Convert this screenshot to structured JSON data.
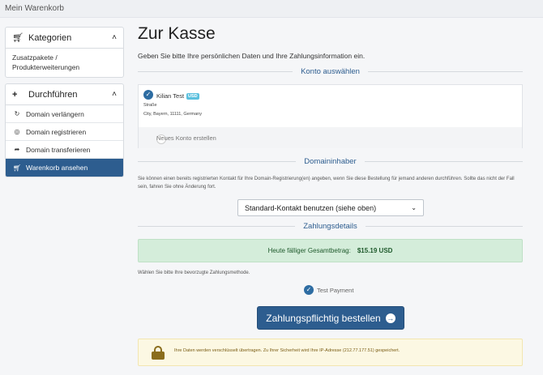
{
  "topbar": {
    "breadcrumb": "Mein Warenkorb"
  },
  "sidebar": {
    "categories": {
      "title": "Kategorien",
      "body": "Zusatzpakete / Produkterweiterungen"
    },
    "actions": {
      "title": "Durchführen",
      "items": [
        {
          "label": "Domain verlängern",
          "icon": "refresh-icon"
        },
        {
          "label": "Domain registrieren",
          "icon": "globe-icon"
        },
        {
          "label": "Domain transferieren",
          "icon": "share-icon"
        },
        {
          "label": "Warenkorb ansehen",
          "icon": "cart-icon",
          "active": true
        }
      ]
    }
  },
  "main": {
    "title": "Zur Kasse",
    "subtitle": "Geben Sie bitte Ihre persönlichen Daten und Ihre Zahlungsinformation ein.",
    "section_account": "Konto auswählen",
    "account": {
      "name": "Kilian Test",
      "currency_badge": "USD",
      "street": "Straße",
      "city_line": "City, Bayern, 11111, Germany",
      "new_account": "Neues Konto erstellen"
    },
    "section_owner": "Domaininhaber",
    "owner_explain": "Sie können einen bereits registrierten Kontakt für Ihre Domain-Registrierung(en) angeben, wenn Sie diese Bestellung für jemand anderen durchführen. Sollte das nicht der Fall sein, fahren Sie ohne Änderung fort.",
    "owner_select": "Standard-Kontakt benutzen (siehe oben)",
    "section_payment": "Zahlungsdetails",
    "total_label": "Heute fälliger Gesamtbetrag:",
    "total_value": "$15.19 USD",
    "payment_hint": "Wählen Sie bitte Ihre bevorzugte Zahlungsmethode.",
    "payment_option": "Test Payment",
    "order_button": "Zahlungspflichtig bestellen",
    "secure_text": "Ihre Daten werden verschlüsselt übertragen. Zu Ihrer Sicherheit wird Ihre IP-Adresse (212.77.177.51) gespeichert."
  },
  "colors": {
    "accent": "#2d5d8f",
    "success_bg": "#d4edda",
    "warning_bg": "#fcf8e3"
  }
}
